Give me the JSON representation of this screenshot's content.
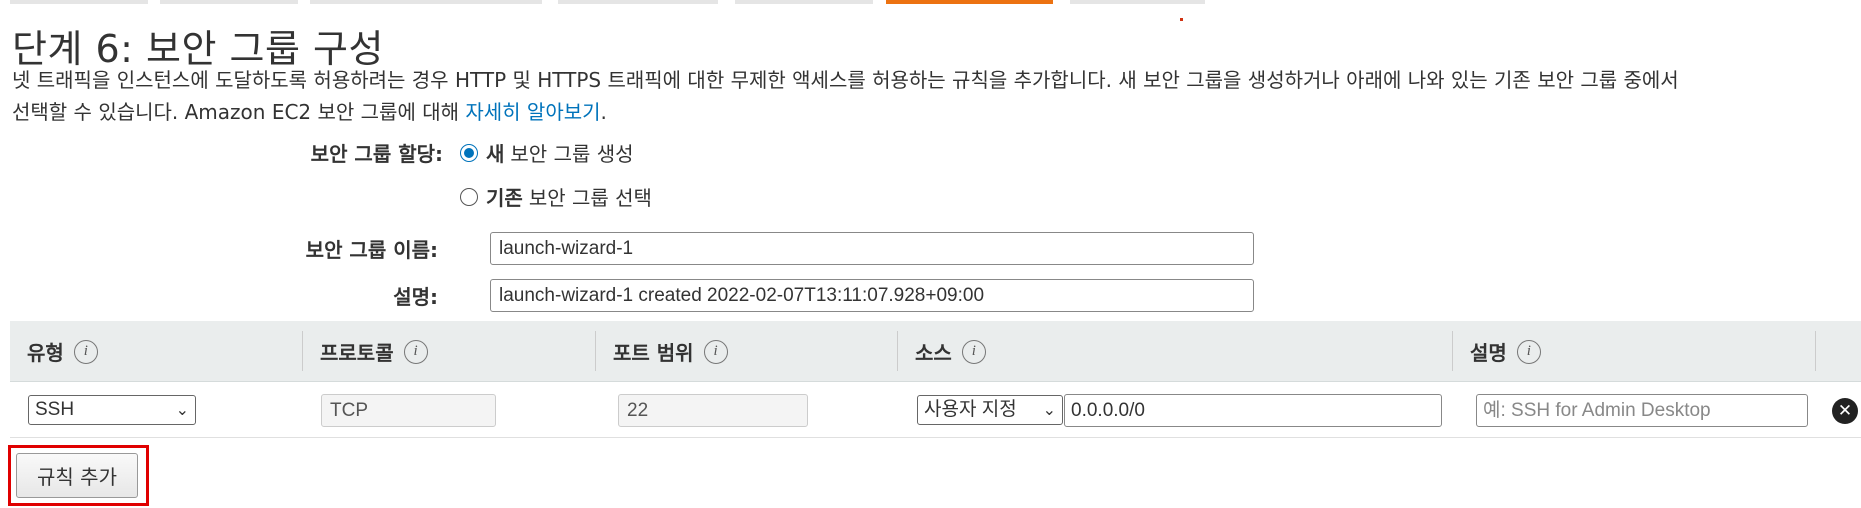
{
  "page": {
    "title": "단계 6: 보안 그룹 구성",
    "intro_line1": "넷 트래픽을 인스턴스에 도달하도록 허용하려는 경우 HTTP 및 HTTPS 트래픽에 대한 무제한 액세스를 허용하는 규칙을 추가합니다. 새 보안 그룹을 생성하거나 아래에 나와 있는 기존 보안 그룹 중에서",
    "intro_line2_prefix": "선택할 수 있습니다. Amazon EC2 보안 그룹에 대해 ",
    "intro_link": "자세히 알아보기",
    "intro_line2_suffix": "."
  },
  "assignment": {
    "label": "보안 그룹 할당:",
    "options": [
      {
        "bold": "새",
        "rest": "보안 그룹 생성",
        "selected": true
      },
      {
        "bold": "기존",
        "rest": "보안 그룹 선택",
        "selected": false
      }
    ]
  },
  "form": {
    "name_label": "보안 그룹 이름:",
    "name_value": "launch-wizard-1",
    "desc_label": "설명:",
    "desc_value": "launch-wizard-1 created 2022-02-07T13:11:07.928+09:00"
  },
  "rules_table": {
    "columns": [
      "유형",
      "프로토콜",
      "포트 범위",
      "소스",
      "설명"
    ],
    "rows": [
      {
        "type": "SSH",
        "protocol": "TCP",
        "port_range": "22",
        "source_type": "사용자 지정",
        "source_value": "0.0.0.0/0",
        "description_placeholder": "예: SSH for Admin Desktop"
      }
    ]
  },
  "add_rule_button": "규칙 추가",
  "icons": {
    "info": "info-icon",
    "remove": "remove-rule-icon",
    "dropdown": "chevron-down-icon"
  },
  "colors": {
    "active_tab": "#ec7211",
    "link": "#0073bb",
    "highlight_outline": "#e00000"
  }
}
